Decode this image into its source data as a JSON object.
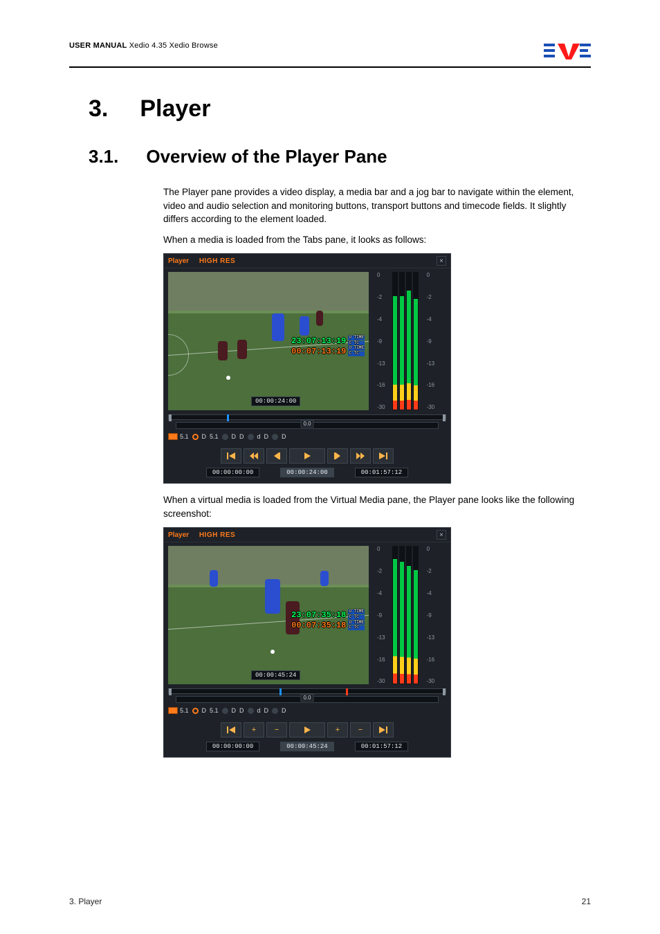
{
  "header": {
    "manual_prefix": "USER MANUAL",
    "product": "Xedio 4.35",
    "module": "Xedio Browse"
  },
  "headings": {
    "h1_num": "3.",
    "h1_text": "Player",
    "h2_num": "3.1.",
    "h2_text": "Overview of the Player Pane"
  },
  "paragraphs": {
    "p1": "The Player pane provides a video display, a media bar and a jog bar to navigate within the element, video and audio selection and monitoring buttons, transport buttons and timecode fields. It slightly differs according to the element loaded.",
    "p2": "When a media is loaded from the Tabs pane, it looks as follows:",
    "p3": "When a virtual media is loaded from the Virtual Media pane, the Player pane looks like the following screenshot:"
  },
  "player_common": {
    "title_left": "Player",
    "title_res": "HIGH RES",
    "close": "×",
    "jog_center": "0.0",
    "scale_labels": [
      "0",
      "-2",
      "-4",
      "-9",
      "-13",
      "-16",
      "-30"
    ],
    "tc_side": [
      "U TIME",
      "C TC",
      "U TIME",
      "C TC"
    ]
  },
  "player_a": {
    "tc_a": "23:07:13:19",
    "tc_b": "00:07:13:19",
    "video_tc": "00:00:24:00",
    "tc_left": "00:00:00:00",
    "tc_mid": "00:00:24:00",
    "tc_right": "00:01:57:12",
    "media_mark_pct": 21,
    "audio": [
      {
        "box": true,
        "label": "5.1"
      },
      {
        "dot": "on"
      },
      {
        "label": "D"
      },
      {
        "label": "5.1"
      },
      {
        "dot": ""
      },
      {
        "label": "D"
      },
      {
        "label": "D"
      },
      {
        "dot": ""
      },
      {
        "label": "d"
      },
      {
        "label": "D"
      },
      {
        "dot": ""
      },
      {
        "label": "D"
      }
    ],
    "transport": [
      "goto-start",
      "prev-fast",
      "prev",
      "step-back",
      "play",
      "step-fwd",
      "next",
      "next-fast",
      "goto-end"
    ]
  },
  "player_b": {
    "tc_a": "23:07:35:18",
    "tc_b": "00:07:35:18",
    "video_tc": "00:00:45:24",
    "tc_left": "00:00:00:00",
    "tc_mid": "00:00:45:24",
    "tc_right": "00:01:57:12",
    "media_mark_pct": 40,
    "media_mark2_pct": 64,
    "audio": [
      {
        "box": true,
        "label": "5.1"
      },
      {
        "dot": "on"
      },
      {
        "label": "D"
      },
      {
        "label": "5.1"
      },
      {
        "dot": ""
      },
      {
        "label": "D"
      },
      {
        "label": "D"
      },
      {
        "dot": ""
      },
      {
        "label": "d"
      },
      {
        "label": "D"
      },
      {
        "dot": ""
      },
      {
        "label": "D"
      }
    ],
    "transport": [
      "goto-start",
      "plus",
      "minus",
      "play",
      "plus",
      "minus",
      "goto-end"
    ]
  },
  "footer": {
    "left": "3. Player",
    "right": "21"
  }
}
